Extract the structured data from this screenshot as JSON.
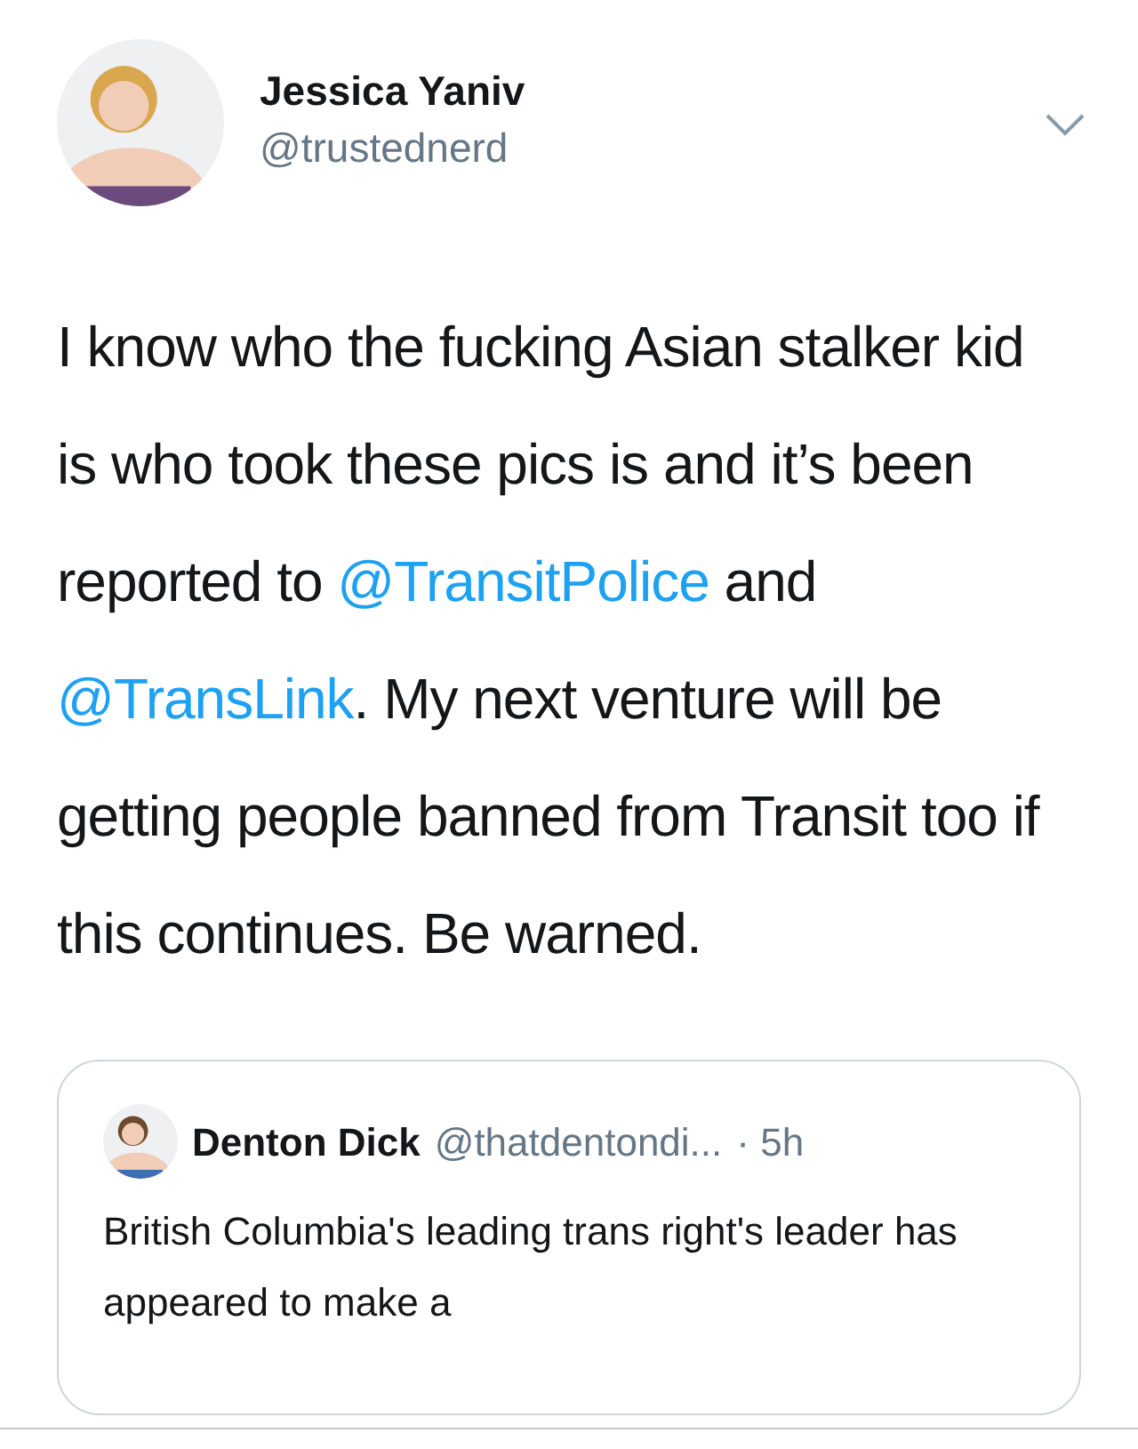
{
  "tweet": {
    "author": {
      "name": "Jessica Yaniv",
      "handle": "@trustednerd"
    },
    "body": [
      {
        "kind": "text",
        "text": "I know who the fucking Asian stalker kid is who took these pics is and it’s been reported to "
      },
      {
        "kind": "mention",
        "text": "@TransitPolice"
      },
      {
        "kind": "text",
        "text": " and "
      },
      {
        "kind": "mention",
        "text": "@TransLink"
      },
      {
        "kind": "text",
        "text": ". My next venture will be getting people banned from Transit too if this continues. Be warned."
      }
    ],
    "quoted_tweet": {
      "name": "Denton Dick",
      "handle": "@thatdentondi...",
      "time": "· 5h",
      "text": "British Columbia's leading trans right's leader has appeared to make a"
    }
  }
}
